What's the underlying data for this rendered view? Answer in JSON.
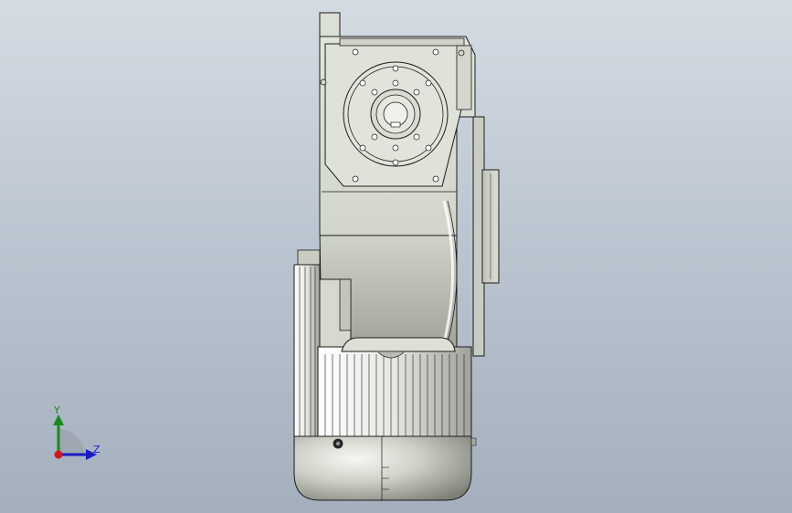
{
  "viewport": {
    "background_top": "#d4dbe3",
    "background_bottom": "#a4afbd"
  },
  "model": {
    "kind": "gear-motor-side-view",
    "body_color": "#d8dbd2",
    "outline_color": "#1c1c1c",
    "fin_color": "#f2f2ee"
  },
  "triad": {
    "y_label": "Y",
    "z_label": "Z",
    "y_color": "#1a8a1a",
    "z_color": "#1a1ac8",
    "origin_color": "#d01818"
  }
}
